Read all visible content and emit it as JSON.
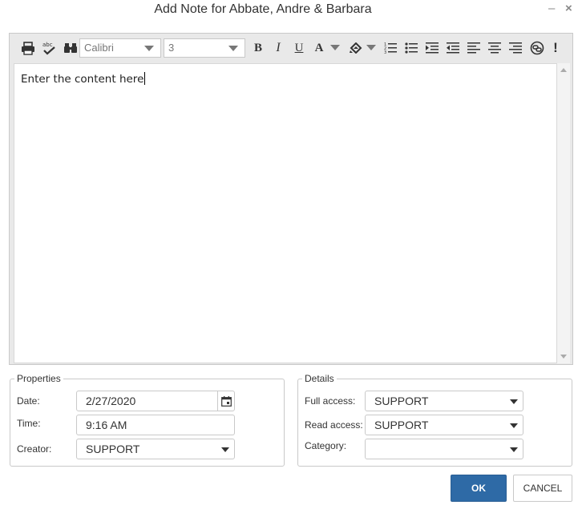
{
  "window": {
    "title": "Add Note for Abbate, Andre & Barbara",
    "minimize_glyph": "–",
    "close_glyph": "×"
  },
  "toolbar": {
    "font_name": "Calibri",
    "font_size": "3",
    "icons": [
      "print-icon",
      "spellcheck-icon",
      "find-icon",
      "bold-icon",
      "italic-icon",
      "underline-icon",
      "font-color-icon",
      "highlight-icon",
      "ordered-list-icon",
      "unordered-list-icon",
      "indent-icon",
      "outdent-icon",
      "align-left-icon",
      "align-center-icon",
      "align-right-icon",
      "link-icon",
      "priority-icon"
    ],
    "bold_glyph": "B",
    "italic_glyph": "I",
    "underline_glyph": "U",
    "font_color_glyph": "A",
    "priority_glyph": "!"
  },
  "editor": {
    "content": "Enter the content here"
  },
  "properties": {
    "legend": "Properties",
    "date_label": "Date:",
    "date_value": "2/27/2020",
    "time_label": "Time:",
    "time_value": "9:16 AM",
    "creator_label": "Creator:",
    "creator_value": "SUPPORT"
  },
  "details": {
    "legend": "Details",
    "full_access_label": "Full access:",
    "full_access_value": "SUPPORT",
    "read_access_label": "Read access:",
    "read_access_value": "SUPPORT",
    "category_label": "Category:",
    "category_value": ""
  },
  "buttons": {
    "ok_label": "OK",
    "cancel_label": "CANCEL"
  },
  "colors": {
    "primary": "#2e6aa6",
    "toolbar_bg": "#e9e9e9"
  }
}
